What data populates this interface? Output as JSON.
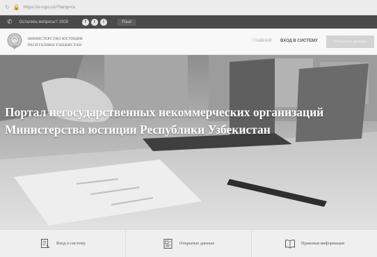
{
  "browser": {
    "url": "https://e-ngo.uz/?lang=ru"
  },
  "topbar": {
    "call_text": "Остались вопросы? 1008",
    "social": [
      "f",
      "t",
      "i"
    ],
    "lang": "Язык"
  },
  "header": {
    "ministry_line1": "МИНИСТЕРСТВО ЮСТИЦИИ",
    "ministry_line2": "РЕСПУБЛИКИ УЗБЕКИСТАН",
    "nav_main": "ГЛАВНАЯ",
    "nav_login": "ВХОД В СИСТЕМУ",
    "open_btn": "Открытые данные"
  },
  "hero": {
    "title": "Портал негосударственных некоммерческих организаций Министерства юстиции Республики Узбекистан"
  },
  "features": [
    {
      "label": "Вход в систему",
      "icon": "document-icon"
    },
    {
      "label": "Открытые данные",
      "icon": "open-data-icon"
    },
    {
      "label": "Правовая информация",
      "icon": "book-icon"
    }
  ]
}
